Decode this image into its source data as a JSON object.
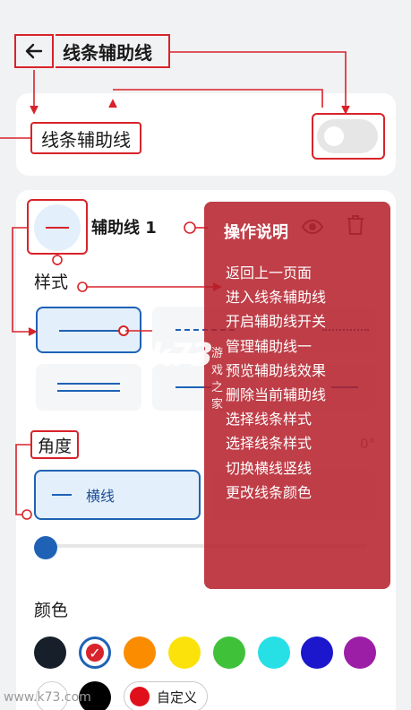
{
  "header": {
    "title": "线条辅助线"
  },
  "toggle_section": {
    "label": "线条辅助线",
    "enabled": false
  },
  "guide_line": {
    "name": "辅助线 1"
  },
  "style_section": {
    "label": "样式"
  },
  "angle_section": {
    "label": "角度",
    "value": "0°",
    "horizontal_label": "横线"
  },
  "color_section": {
    "label": "颜色",
    "swatches": [
      "#17202a",
      "#d8232a",
      "#fb8c00",
      "#fbe20a",
      "#3fc23a",
      "#26e0e6",
      "#1c17cc",
      "#9c1ea6",
      "#ffffff",
      "#000000"
    ],
    "selected_index": 1,
    "custom_label": "自定义",
    "custom_color": "#e0101a"
  },
  "overlay": {
    "title": "操作说明",
    "items": [
      "返回上一页面",
      "进入线条辅助线",
      "开启辅助线开关",
      "管理辅助线一",
      "预览辅助线效果",
      "删除当前辅助线",
      "选择线条样式",
      "选择线条样式",
      "切换横线竖线",
      "更改线条颜色"
    ]
  },
  "watermark": {
    "logo": "k73",
    "sub": "游戏之家",
    "url": "www.k73.com"
  },
  "colors": {
    "accent": "#1f62b5",
    "annotation": "#d8232a",
    "overlay": "#b41e2a"
  }
}
